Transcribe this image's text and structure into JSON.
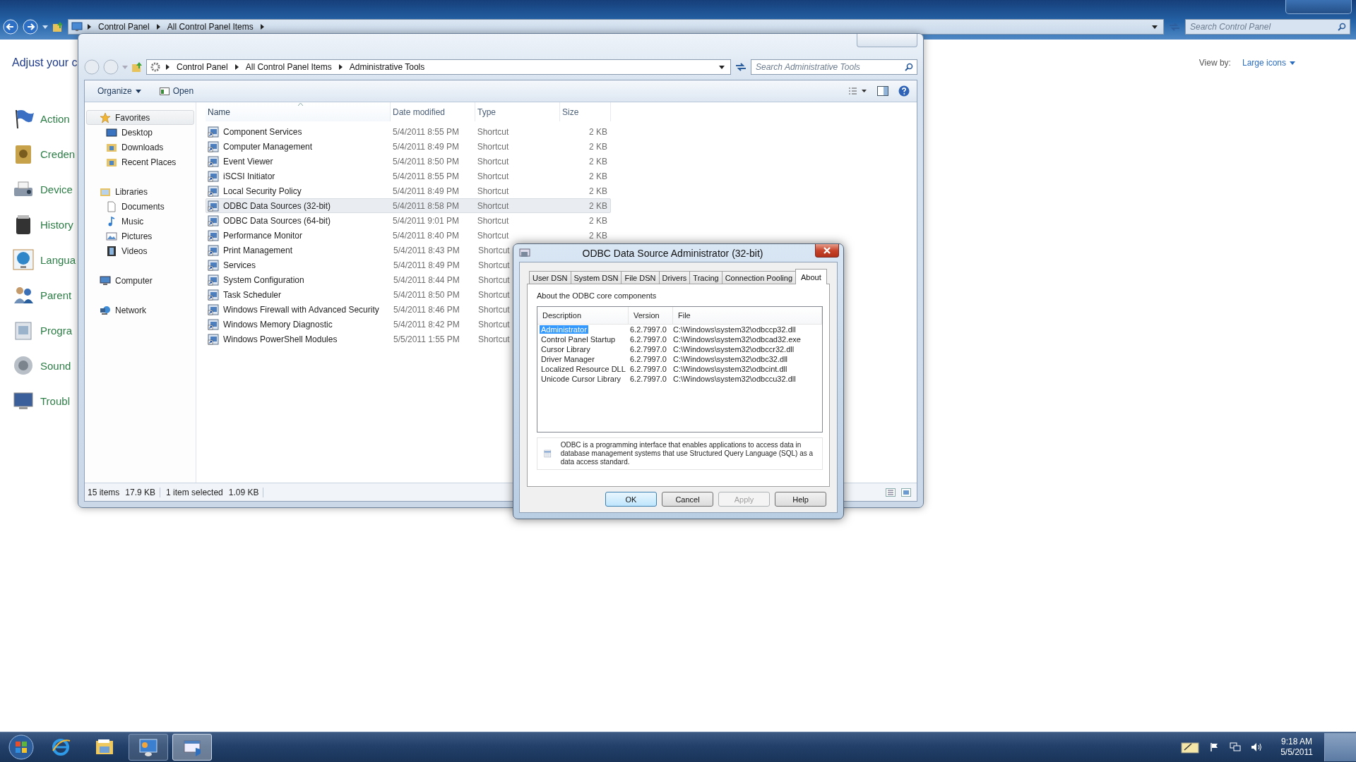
{
  "control_panel": {
    "breadcrumb": [
      "Control Panel",
      "All Control Panel Items"
    ],
    "search": {
      "placeholder": "Search Control Panel"
    },
    "heading": "Adjust your c",
    "view_by": {
      "label": "View by:",
      "value": "Large icons"
    },
    "items": [
      {
        "kind": "flag",
        "label": "Action"
      },
      {
        "kind": "safe",
        "label": "Creden"
      },
      {
        "kind": "printer",
        "label": "Device"
      },
      {
        "kind": "jar",
        "label": "History"
      },
      {
        "kind": "globe",
        "label": "Langua"
      },
      {
        "kind": "people",
        "label": "Parent"
      },
      {
        "kind": "box",
        "label": "Progra"
      },
      {
        "kind": "speaker",
        "label": "Sound"
      },
      {
        "kind": "monitor",
        "label": "Troubl"
      }
    ]
  },
  "explorer": {
    "breadcrumb": [
      "Control Panel",
      "All Control Panel Items",
      "Administrative Tools"
    ],
    "search": {
      "placeholder": "Search Administrative Tools"
    },
    "toolbar": [
      {
        "label": "Organize",
        "kind": "menu"
      },
      {
        "label": "Open",
        "kind": "open"
      }
    ],
    "sidebar": [
      {
        "label": "Favorites",
        "kind": "star",
        "selected": true,
        "children": [
          {
            "label": "Desktop",
            "kind": "desktop",
            "selected": false
          },
          {
            "label": "Downloads",
            "kind": "downloads",
            "selected": false
          },
          {
            "label": "Recent Places",
            "kind": "places",
            "selected": false
          }
        ]
      },
      {
        "label": "Libraries",
        "kind": "library",
        "selected": false,
        "children": [
          {
            "label": "Documents",
            "kind": "document",
            "selected": false
          },
          {
            "label": "Music",
            "kind": "music",
            "selected": false
          },
          {
            "label": "Pictures",
            "kind": "picture",
            "selected": false
          },
          {
            "label": "Videos",
            "kind": "video",
            "selected": false
          }
        ]
      },
      {
        "label": "Computer",
        "kind": "computer",
        "selected": false
      },
      {
        "label": "Network",
        "kind": "network",
        "selected": false
      }
    ],
    "columns": [
      {
        "label": "Name",
        "sorted": true
      },
      {
        "label": "Date modified",
        "sorted": false
      },
      {
        "label": "Type",
        "sorted": false
      },
      {
        "label": "Size",
        "sorted": false
      }
    ],
    "rows": [
      {
        "name": "Component Services",
        "date": "5/4/2011 8:55 PM",
        "type": "Shortcut",
        "size": "2 KB",
        "selected": false
      },
      {
        "name": "Computer Management",
        "date": "5/4/2011 8:49 PM",
        "type": "Shortcut",
        "size": "2 KB",
        "selected": false
      },
      {
        "name": "Event Viewer",
        "date": "5/4/2011 8:50 PM",
        "type": "Shortcut",
        "size": "2 KB",
        "selected": false
      },
      {
        "name": "iSCSI Initiator",
        "date": "5/4/2011 8:55 PM",
        "type": "Shortcut",
        "size": "2 KB",
        "selected": false
      },
      {
        "name": "Local Security Policy",
        "date": "5/4/2011 8:49 PM",
        "type": "Shortcut",
        "size": "2 KB",
        "selected": false
      },
      {
        "name": "ODBC Data Sources (32-bit)",
        "date": "5/4/2011 8:58 PM",
        "type": "Shortcut",
        "size": "2 KB",
        "selected": true
      },
      {
        "name": "ODBC Data Sources (64-bit)",
        "date": "5/4/2011 9:01 PM",
        "type": "Shortcut",
        "size": "2 KB",
        "selected": false
      },
      {
        "name": "Performance Monitor",
        "date": "5/4/2011 8:40 PM",
        "type": "Shortcut",
        "size": "2 KB",
        "selected": false
      },
      {
        "name": "Print Management",
        "date": "5/4/2011 8:43 PM",
        "type": "Shortcut",
        "selected": false
      },
      {
        "name": "Services",
        "date": "5/4/2011 8:49 PM",
        "type": "Shortcut",
        "selected": false
      },
      {
        "name": "System Configuration",
        "date": "5/4/2011 8:44 PM",
        "type": "Shortcut",
        "selected": false
      },
      {
        "name": "Task Scheduler",
        "date": "5/4/2011 8:50 PM",
        "type": "Shortcut",
        "selected": false
      },
      {
        "name": "Windows Firewall with Advanced Security",
        "date": "5/4/2011 8:46 PM",
        "type": "Shortcut",
        "selected": false
      },
      {
        "name": "Windows Memory Diagnostic",
        "date": "5/4/2011 8:42 PM",
        "type": "Shortcut",
        "selected": false
      },
      {
        "name": "Windows PowerShell Modules",
        "date": "5/5/2011 1:55 PM",
        "type": "Shortcut",
        "selected": false
      }
    ],
    "status_bar": [
      {
        "count": "15 items",
        "size": "17.9 KB"
      },
      {
        "count": "1 item selected",
        "size": "1.09 KB"
      }
    ]
  },
  "dialog": {
    "title": "ODBC Data Source Administrator (32-bit)",
    "tabs": [
      {
        "label": "User DSN",
        "selected": false
      },
      {
        "label": "System DSN",
        "selected": false
      },
      {
        "label": "File DSN",
        "selected": false
      },
      {
        "label": "Drivers",
        "selected": false
      },
      {
        "label": "Tracing",
        "selected": false
      },
      {
        "label": "Connection Pooling",
        "selected": false
      },
      {
        "label": "About",
        "selected": true
      }
    ],
    "caption": "About the ODBC core components",
    "columns": [
      "Description",
      "Version",
      "File"
    ],
    "rows": [
      {
        "description": "Administrator",
        "version": "6.2.7997.0",
        "file": "C:\\Windows\\system32\\odbccp32.dll",
        "selected": true
      },
      {
        "description": "Control Panel Startup",
        "version": "6.2.7997.0",
        "file": "C:\\Windows\\system32\\odbcad32.exe",
        "selected": false
      },
      {
        "description": "Cursor Library",
        "version": "6.2.7997.0",
        "file": "C:\\Windows\\system32\\odbccr32.dll",
        "selected": false
      },
      {
        "description": "Driver Manager",
        "version": "6.2.7997.0",
        "file": "C:\\Windows\\system32\\odbc32.dll",
        "selected": false
      },
      {
        "description": "Localized Resource DLL",
        "version": "6.2.7997.0",
        "file": "C:\\Windows\\system32\\odbcint.dll",
        "selected": false
      },
      {
        "description": "Unicode Cursor Library",
        "version": "6.2.7997.0",
        "file": "C:\\Windows\\system32\\odbccu32.dll",
        "selected": false
      }
    ],
    "info": "ODBC is a programming interface that enables applications to access data in database management systems that use Structured Query Language (SQL) as a data access standard.",
    "buttons": [
      {
        "label": "OK",
        "kind": "default"
      },
      {
        "label": "Cancel",
        "kind": "normal"
      },
      {
        "label": "Apply",
        "kind": "disabled"
      },
      {
        "label": "Help",
        "kind": "normal"
      }
    ]
  },
  "taskbar": {
    "apps": [
      {
        "kind": "browser",
        "running": false,
        "active": false
      },
      {
        "kind": "folder",
        "running": false,
        "active": false
      },
      {
        "kind": "control-panel",
        "running": true,
        "active": false
      },
      {
        "kind": "admin-tools",
        "running": true,
        "active": true
      }
    ],
    "clock": {
      "time": "9:18 AM",
      "date": "5/5/2011"
    }
  }
}
